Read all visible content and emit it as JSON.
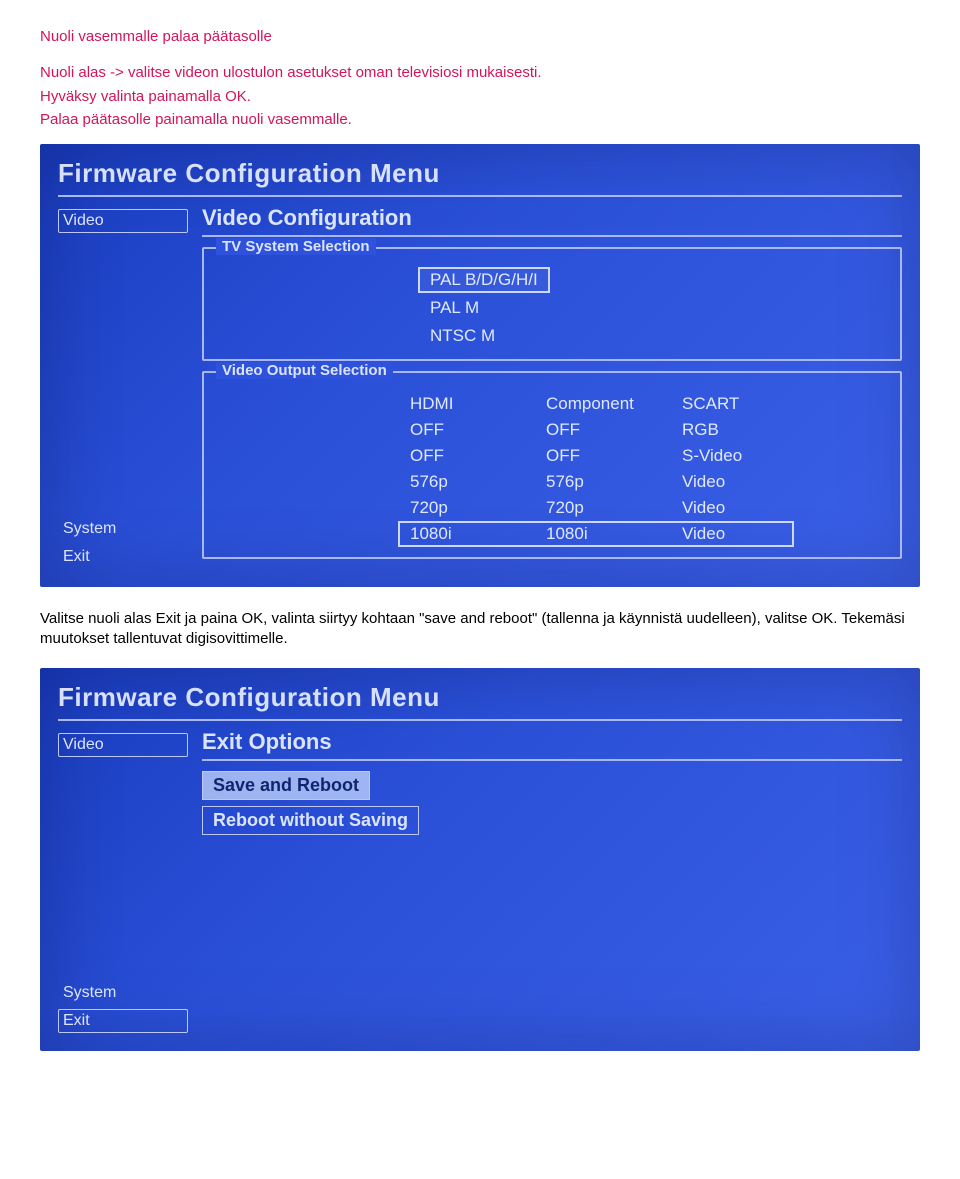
{
  "instructions": {
    "line1": "Nuoli vasemmalle palaa päätasolle",
    "line2": "Nuoli alas -> valitse videon ulostulon asetukset oman televisiosi mukaisesti.",
    "line3": "Hyväksy valinta painamalla OK.",
    "line4": "Palaa päätasolle painamalla nuoli vasemmalle."
  },
  "between_text": "Valitse nuoli alas Exit ja paina OK, valinta siirtyy kohtaan \"save and reboot\" (tallenna ja käynnistä uudelleen), valitse OK. Tekemäsi muutokset tallentuvat digisovittimelle.",
  "screen1": {
    "title": "Firmware Configuration Menu",
    "sidebar": {
      "video": "Video",
      "system": "System",
      "exit": "Exit"
    },
    "section_title": "Video Configuration",
    "tv_system": {
      "label": "TV System Selection",
      "options": [
        "PAL B/D/G/H/I",
        "PAL M",
        "NTSC M"
      ],
      "selected_index": 0
    },
    "video_output": {
      "label": "Video Output Selection",
      "headers": [
        "HDMI",
        "Component",
        "SCART"
      ],
      "rows": [
        [
          "OFF",
          "OFF",
          "RGB"
        ],
        [
          "OFF",
          "OFF",
          "S-Video"
        ],
        [
          "576p",
          "576p",
          "Video"
        ],
        [
          "720p",
          "720p",
          "Video"
        ],
        [
          "1080i",
          "1080i",
          "Video"
        ]
      ],
      "selected_row_index": 4
    }
  },
  "screen2": {
    "title": "Firmware Configuration Menu",
    "sidebar": {
      "video": "Video",
      "system": "System",
      "exit": "Exit"
    },
    "section_title": "Exit Options",
    "exit_options": {
      "items": [
        "Save and Reboot",
        "Reboot without Saving"
      ],
      "selected_index": 0
    }
  }
}
